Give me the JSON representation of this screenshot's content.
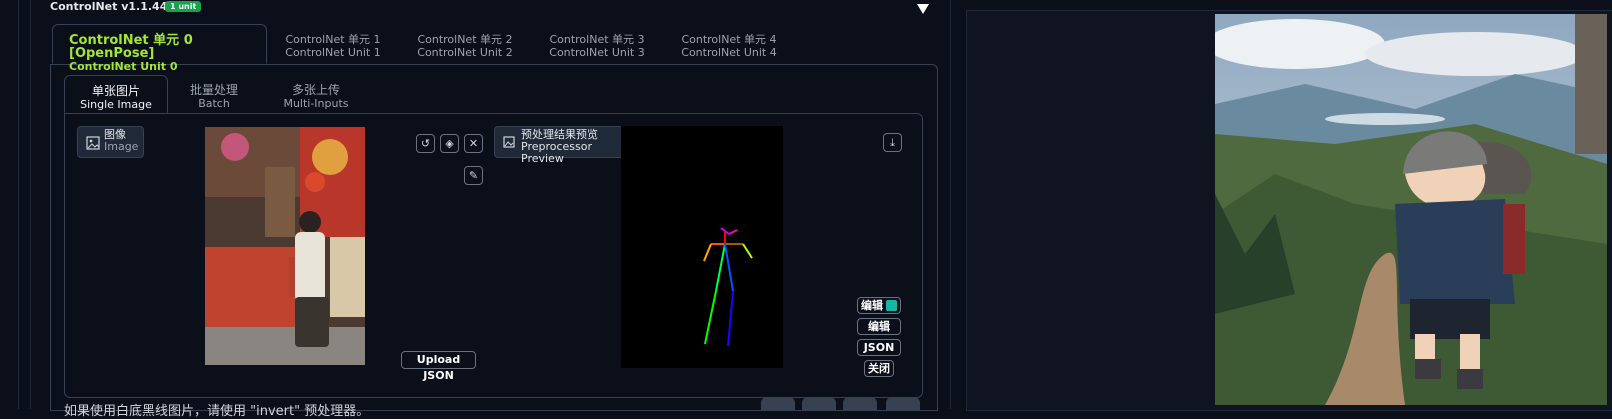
{
  "header": {
    "title": "ControlNet v1.1.449",
    "badge": "1 unit"
  },
  "unit_tabs": [
    {
      "zh": "ControlNet 单元 0",
      "mode": "[OpenPose]",
      "en": "ControlNet Unit 0"
    },
    {
      "zh": "ControlNet 单元 1",
      "en": "ControlNet Unit 1"
    },
    {
      "zh": "ControlNet 单元 2",
      "en": "ControlNet Unit 2"
    },
    {
      "zh": "ControlNet 单元 3",
      "en": "ControlNet Unit 3"
    },
    {
      "zh": "ControlNet 单元 4",
      "en": "ControlNet Unit 4"
    }
  ],
  "input_tabs": [
    {
      "zh": "单张图片",
      "en": "Single Image"
    },
    {
      "zh": "批量处理",
      "en": "Batch"
    },
    {
      "zh": "多张上传",
      "en": "Multi-Inputs"
    }
  ],
  "image_label": {
    "zh": "图像",
    "en": "Image"
  },
  "preview_label": {
    "zh": "预处理结果预览",
    "en": "Preprocessor Preview"
  },
  "buttons": {
    "upload_json": "Upload JSON",
    "edit_1": "编辑",
    "edit_2": "编辑",
    "json": "JSON",
    "close": "关闭"
  },
  "footer_hint": "如果使用白底黑线图片，请使用 \"invert\" 预处理器。",
  "colors": {
    "accent": "#a3e635",
    "badge": "#16a34a",
    "bg": "#0b0f19"
  }
}
